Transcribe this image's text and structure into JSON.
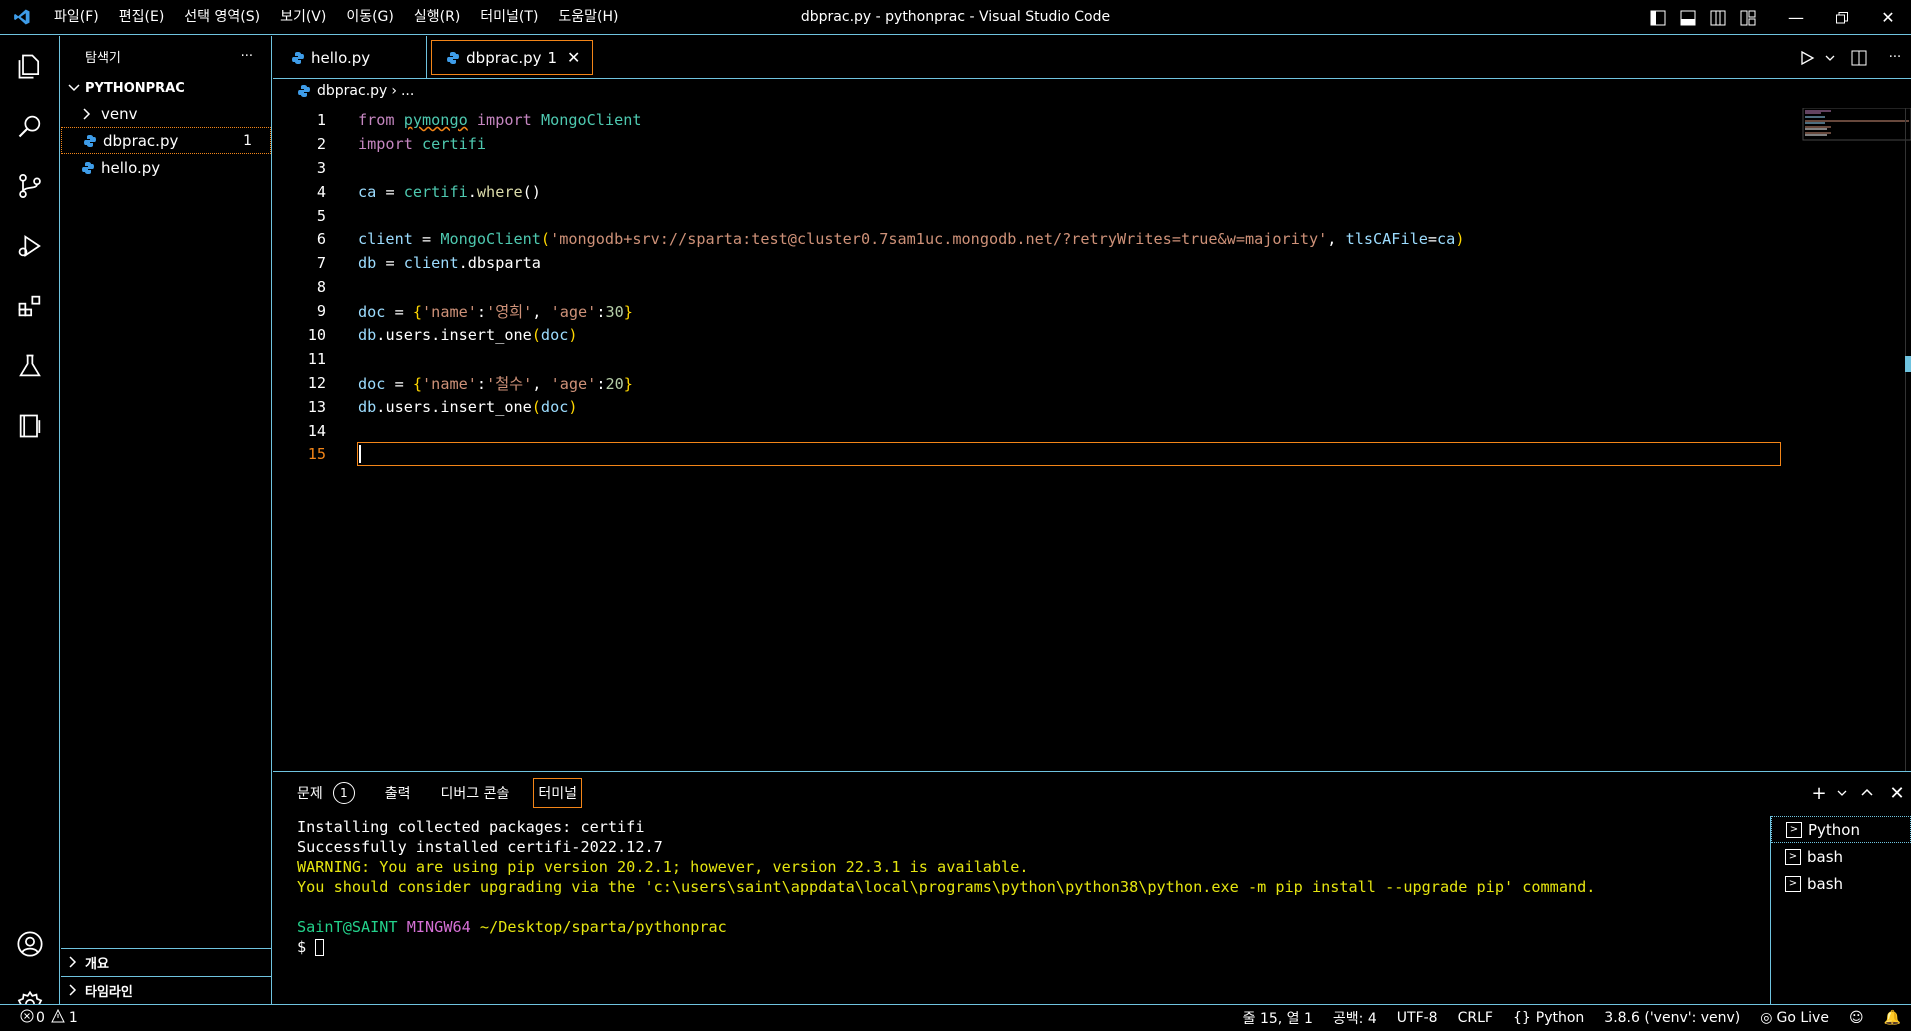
{
  "window": {
    "title": "dbprac.py - pythonprac - Visual Studio Code"
  },
  "menu": [
    "파일(F)",
    "편집(E)",
    "선택 영역(S)",
    "보기(V)",
    "이동(G)",
    "실행(R)",
    "터미널(T)",
    "도움말(H)"
  ],
  "sidebar": {
    "title": "탐색기",
    "more": "···",
    "folder": "PYTHONPRAC",
    "items": [
      {
        "label": "venv",
        "type": "folder"
      },
      {
        "label": "dbprac.py",
        "badge": "1"
      },
      {
        "label": "hello.py"
      }
    ],
    "outline": "개요",
    "timeline": "타임라인"
  },
  "tabs": [
    {
      "label": "hello.py"
    },
    {
      "label": "dbprac.py",
      "badge": "1"
    }
  ],
  "breadcrumb": {
    "file": "dbprac.py",
    "rest": "..."
  },
  "code": {
    "line_numbers": [
      "1",
      "2",
      "3",
      "4",
      "5",
      "6",
      "7",
      "8",
      "9",
      "10",
      "11",
      "12",
      "13",
      "14",
      "15"
    ],
    "l1": {
      "from": "from",
      "mod": "pymongo",
      "import": "import",
      "cls": "MongoClient"
    },
    "l2": {
      "import": "import",
      "mod": "certifi"
    },
    "l4": {
      "var": "ca",
      "eq": " = ",
      "obj": "certifi",
      "dot": ".",
      "fn": "where",
      "paren": "()"
    },
    "l6": {
      "var": "client",
      "eq": " = ",
      "fn": "MongoClient",
      "open": "(",
      "str": "'mongodb+srv://sparta:test@cluster0.7sam1uc.mongodb.net/?retryWrites=true&w=majority'",
      "comma": ", ",
      "kw": "tlsCAFile",
      "eq2": "=",
      "arg": "ca",
      "close": ")"
    },
    "l7": {
      "var": "db",
      "eq": " = ",
      "obj": "client",
      "dot": ".",
      "attr": "dbsparta"
    },
    "l9": {
      "var": "doc",
      "eq": " = ",
      "ob": "{",
      "k1": "'name'",
      "c1": ":",
      "v1": "'영희'",
      "comma": ", ",
      "k2": "'age'",
      "c2": ":",
      "v2": "30",
      "cb": "}"
    },
    "l10": {
      "obj": "db",
      "dot": ".",
      "users": "users",
      "dot2": ".",
      "fn": "insert_one",
      "open": "(",
      "arg": "doc",
      "close": ")"
    },
    "l12": {
      "var": "doc",
      "eq": " = ",
      "ob": "{",
      "k1": "'name'",
      "c1": ":",
      "v1": "'철수'",
      "comma": ", ",
      "k2": "'age'",
      "c2": ":",
      "v2": "20",
      "cb": "}"
    },
    "l13": {
      "obj": "db",
      "dot": ".",
      "users": "users",
      "dot2": ".",
      "fn": "insert_one",
      "open": "(",
      "arg": "doc",
      "close": ")"
    }
  },
  "panel": {
    "tabs": [
      "문제",
      "출력",
      "디버그 콘솔",
      "터미널"
    ],
    "problems_badge": "1",
    "terminal_lines": [
      "Installing collected packages: certifi",
      "Successfully installed certifi-2022.12.7"
    ],
    "warning_lines": [
      "WARNING: You are using pip version 20.2.1; however, version 22.3.1 is available.",
      "You should consider upgrading via the 'c:\\users\\saint\\appdata\\local\\programs\\python\\python38\\python.exe -m pip install --upgrade pip' command."
    ],
    "prompt_user": "SainT@SAINT",
    "prompt_env": "MINGW64",
    "prompt_path": "~/Desktop/sparta/pythonprac",
    "prompt_symbol": "$",
    "terminals": [
      "Python",
      "bash",
      "bash"
    ]
  },
  "status": {
    "errors": "0",
    "warnings": "1",
    "position": "줄 15, 열 1",
    "spaces": "공백: 4",
    "encoding": "UTF-8",
    "eol": "CRLF",
    "language": "Python",
    "interpreter": "3.8.6 ('venv': venv)",
    "golive": "Go Live"
  },
  "colors": {
    "accent": "#f38518",
    "border": "#6fc3df",
    "string": "#ce9178",
    "keyword": "#c586c0"
  }
}
